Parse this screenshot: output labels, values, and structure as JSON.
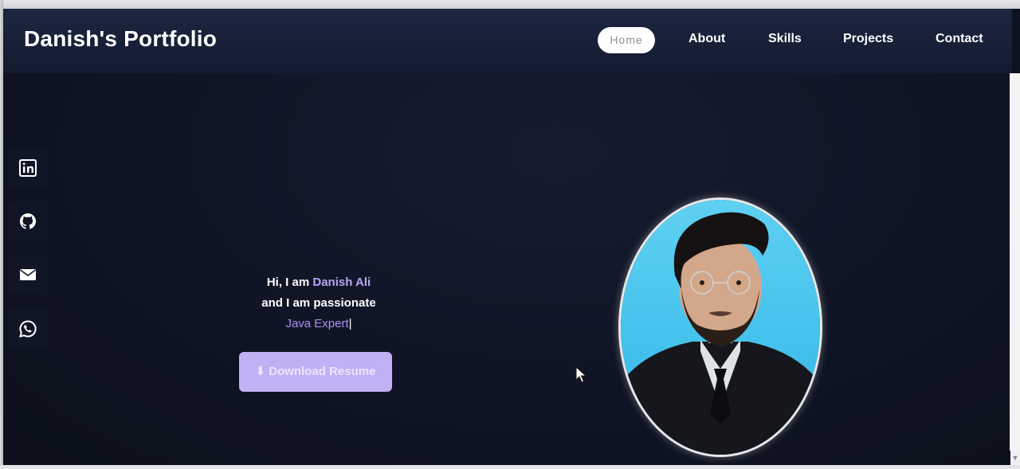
{
  "header": {
    "brand": "Danish's Portfolio",
    "nav": [
      {
        "label": "Home",
        "active": true
      },
      {
        "label": "About"
      },
      {
        "label": "Skills"
      },
      {
        "label": "Projects"
      },
      {
        "label": "Contact"
      }
    ]
  },
  "social": [
    {
      "icon": "linkedin-icon"
    },
    {
      "icon": "github-icon"
    },
    {
      "icon": "mail-icon"
    },
    {
      "icon": "whatsapp-icon"
    }
  ],
  "hero": {
    "greeting_prefix": "Hi, I am ",
    "name": "Danish Ali",
    "line2": "and I am passionate",
    "role": "Java Expert",
    "cursor": "|",
    "download_label": "⬇ Download Resume"
  },
  "colors": {
    "accent": "#b7a6f5",
    "button": "#c2b0f5",
    "background": "#0d1120",
    "navbar": "#1c2640"
  }
}
